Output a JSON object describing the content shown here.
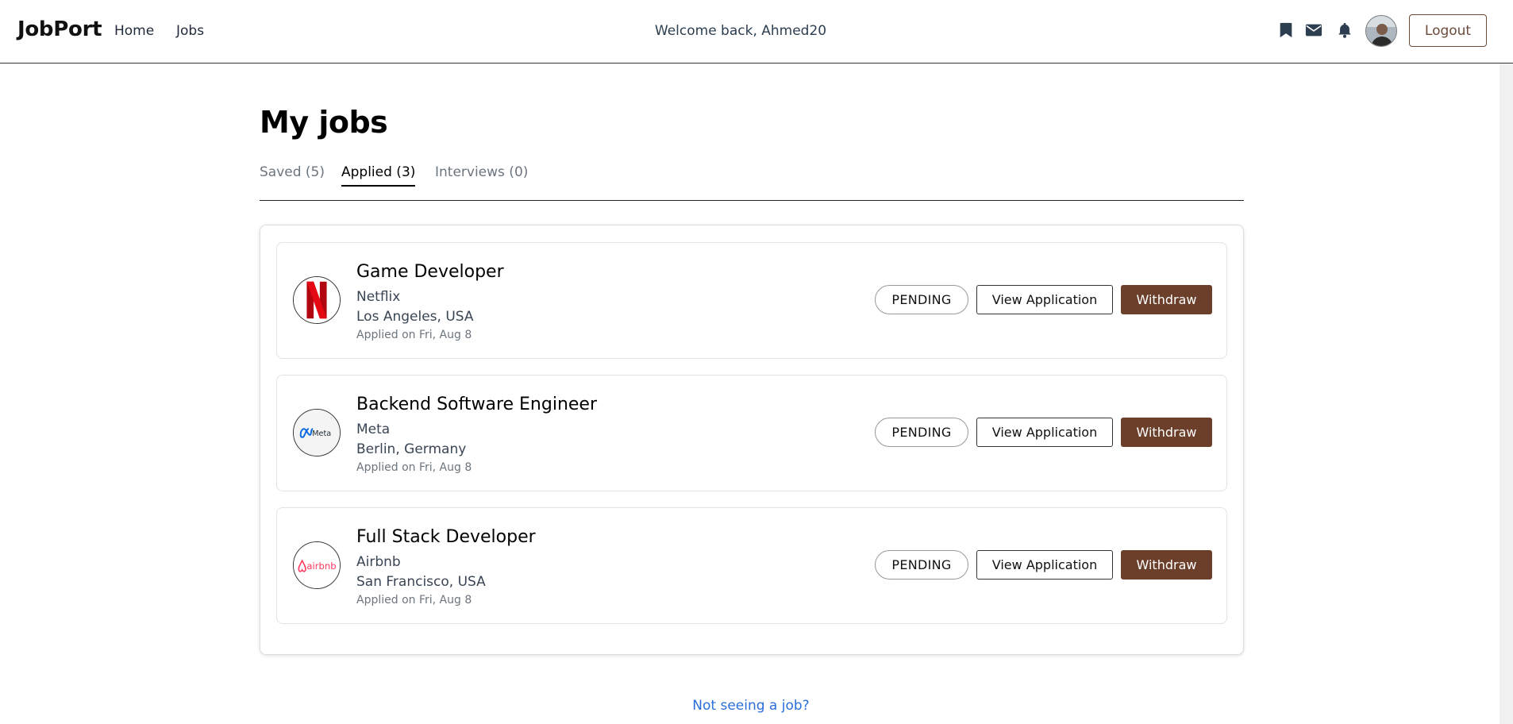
{
  "navbar": {
    "brand": "JobPort",
    "links": [
      "Home",
      "Jobs"
    ],
    "welcome": "Welcome back, Ahmed20",
    "logout_label": "Logout",
    "icons": [
      "bookmark-icon",
      "mail-icon",
      "bell-icon"
    ]
  },
  "page": {
    "title": "My jobs",
    "tabs": [
      {
        "label": "Saved (5)",
        "active": false
      },
      {
        "label": "Applied (3)",
        "active": true
      },
      {
        "label": "Interviews (0)",
        "active": false
      }
    ]
  },
  "jobs": [
    {
      "title": "Game Developer",
      "company": "Netflix",
      "location": "Los Angeles, USA",
      "applied": "Applied on Fri, Aug 8",
      "status": "PENDING",
      "view_label": "View Application",
      "withdraw_label": "Withdraw",
      "logo": "netflix-logo"
    },
    {
      "title": "Backend Software Engineer",
      "company": "Meta",
      "location": "Berlin, Germany",
      "applied": "Applied on Fri, Aug 8",
      "status": "PENDING",
      "view_label": "View Application",
      "withdraw_label": "Withdraw",
      "logo": "meta-logo",
      "logo_text": "Meta"
    },
    {
      "title": "Full Stack Developer",
      "company": "Airbnb",
      "location": "San Francisco, USA",
      "applied": "Applied on Fri, Aug 8",
      "status": "PENDING",
      "view_label": "View Application",
      "withdraw_label": "Withdraw",
      "logo": "airbnb-logo",
      "logo_text": "airbnb"
    }
  ],
  "footer": {
    "not_seeing": "Not seeing a job?"
  },
  "colors": {
    "accent_brown": "#6b3f2a",
    "link_blue": "#2a6fdb",
    "netflix_red": "#e50914",
    "meta_blue": "#0668e1",
    "airbnb_pink": "#ff385c"
  }
}
